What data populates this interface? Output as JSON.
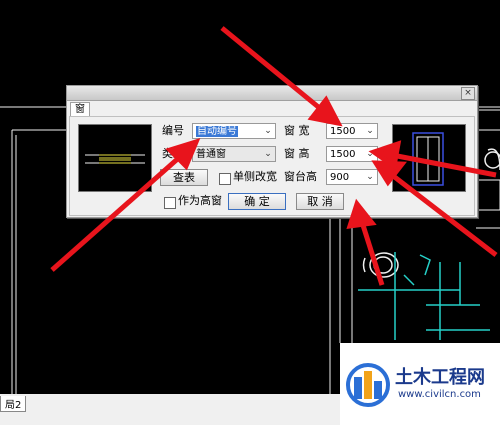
{
  "dialog": {
    "close_glyph": "×",
    "tab_label": "窗",
    "labels": {
      "code": "编号",
      "type": "类型",
      "width": "窗 宽",
      "height": "窗 高",
      "sill_height": "窗台高",
      "single_side_width": "单侧改宽",
      "as_high_window": "作为高窗"
    },
    "fields": {
      "code_value": "自动编号",
      "type_value": "普通窗",
      "width_value": "1500",
      "height_value": "1500",
      "sill_height_value": "900"
    },
    "buttons": {
      "lookup": "查表",
      "ok": "确 定",
      "cancel": "取 消"
    }
  },
  "background": {
    "layout_tab": "局2"
  },
  "watermark": {
    "title": "土木工程网",
    "url": "www.civilcn.com"
  },
  "colors": {
    "annotation_arrow": "#e8141c",
    "cad_background": "#000000",
    "selection": "#3a79d6"
  }
}
